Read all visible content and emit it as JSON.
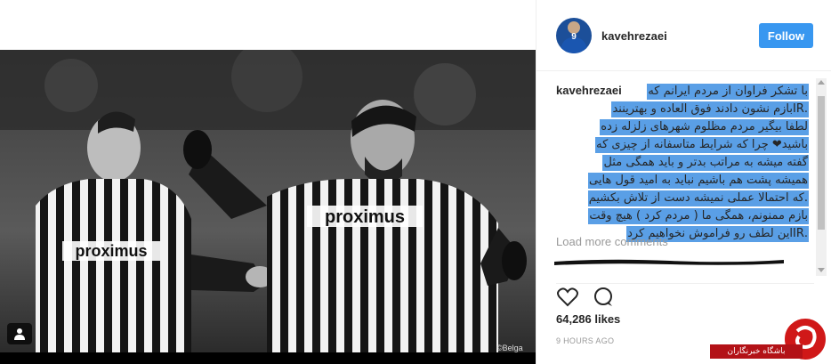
{
  "post": {
    "photo_credit": "©Belga",
    "photo_jersey_text_left": "proximus",
    "photo_jersey_text_right": "proximus"
  },
  "header": {
    "username": "kavehrezaei",
    "follow_label": "Follow",
    "avatar_number": "9"
  },
  "caption": {
    "username": "kavehrezaei",
    "lines": [
      "با تشکر فراوان از مردم ایرانم که",
      ".IRبازم نشون دادند فوق العاده و بهترینند",
      "لطفا بیگیر مردم مظلوم شهرهای زلزله زده",
      "باشید❤ چرا که شرایط متاسفانه از چیزی که",
      "گفته میشه به مراتب بدتر و باید همگی مثل",
      "همیشه پشت هم باشیم نباید به امید قول هایی",
      ".که احتمالا عملی نمیشه دست از تلاش بکشیم",
      "بازم ممنونم، همگی ما ( مردم کرد ) هیچ وقت",
      ".IRاین لطف رو فراموش نخواهیم کرد"
    ]
  },
  "comments": {
    "load_more": "Load more comments"
  },
  "stats": {
    "likes": "64,286 likes",
    "time": "9 HOURS AGO"
  },
  "watermark": {
    "text": "باشگاه خبرنگاران"
  },
  "colors": {
    "follow": "#3897f0",
    "highlight": "#5a9fe6",
    "watermark_red": "#d01818"
  }
}
